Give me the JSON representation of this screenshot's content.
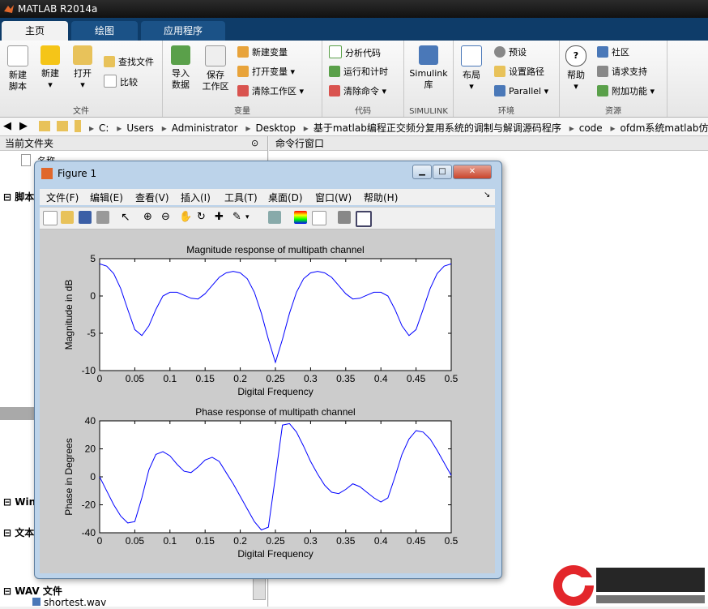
{
  "app": {
    "title": "MATLAB R2014a"
  },
  "tabs": [
    {
      "label": "主页",
      "active": true
    },
    {
      "label": "绘图",
      "active": false
    },
    {
      "label": "应用程序",
      "active": false
    }
  ],
  "ribbon": {
    "file": {
      "group": "文件",
      "new_script": [
        "新建",
        "脚本"
      ],
      "new": "新建",
      "open": "打开",
      "find_files": "查找文件",
      "compare": "比较"
    },
    "variable": {
      "group": "变量",
      "import": [
        "导入",
        "数据"
      ],
      "save_ws": [
        "保存",
        "工作区"
      ],
      "new_var": "新建变量",
      "open_var": "打开变量",
      "clear_ws": "清除工作区"
    },
    "code": {
      "group": "代码",
      "analyze": "分析代码",
      "run_time": "运行和计时",
      "clear_cmd": "清除命令"
    },
    "simulink": {
      "group": "SIMULINK",
      "lib": [
        "Simulink",
        "库"
      ]
    },
    "env": {
      "group": "环境",
      "layout": "布局",
      "prefs": "预设",
      "set_path": "设置路径",
      "parallel": "Parallel"
    },
    "resources": {
      "group": "资源",
      "help": "帮助",
      "community": "社区",
      "support": "请求支持",
      "addons": "附加功能"
    }
  },
  "address": {
    "crumbs": [
      "C:",
      "Users",
      "Administrator",
      "Desktop",
      "基于matlab编程正交频分复用系统的调制与解调源码程序",
      "code",
      "ofdm系统matlab仿"
    ]
  },
  "left_panel": {
    "title": "当前文件夹",
    "col_name": "名称",
    "sections": [
      "脚本",
      "Win",
      "文本",
      "WAV 文件"
    ],
    "file": "shortest.wav"
  },
  "cmd_panel": {
    "title": "命令行窗口"
  },
  "figure": {
    "title": "Figure 1",
    "menus": [
      "文件(F)",
      "编辑(E)",
      "查看(V)",
      "插入(I)",
      "工具(T)",
      "桌面(D)",
      "窗口(W)",
      "帮助(H)"
    ]
  },
  "chart_data": [
    {
      "type": "line",
      "title": "Magnitude response of multipath channel",
      "xlabel": "Digital Frequency",
      "ylabel": "Magnitude in dB",
      "xlim": [
        0,
        0.5
      ],
      "ylim": [
        -10,
        5
      ],
      "xticks": [
        "0",
        "0.05",
        "0.1",
        "0.15",
        "0.2",
        "0.25",
        "0.3",
        "0.35",
        "0.4",
        "0.45",
        "0.5"
      ],
      "yticks": [
        "5",
        "0",
        "-5",
        "-10"
      ],
      "grid": false,
      "color": "#0000ff",
      "x": [
        0,
        0.01,
        0.02,
        0.03,
        0.04,
        0.05,
        0.06,
        0.07,
        0.08,
        0.09,
        0.1,
        0.11,
        0.12,
        0.13,
        0.14,
        0.15,
        0.16,
        0.17,
        0.18,
        0.19,
        0.2,
        0.21,
        0.22,
        0.23,
        0.24,
        0.25,
        0.26,
        0.27,
        0.28,
        0.29,
        0.3,
        0.31,
        0.32,
        0.33,
        0.34,
        0.35,
        0.36,
        0.37,
        0.38,
        0.39,
        0.4,
        0.41,
        0.42,
        0.43,
        0.44,
        0.45,
        0.46,
        0.47,
        0.48,
        0.49,
        0.5
      ],
      "y": [
        4.3,
        4.0,
        3.0,
        1.0,
        -1.8,
        -4.5,
        -5.3,
        -4.0,
        -1.8,
        0.0,
        0.5,
        0.5,
        0.1,
        -0.3,
        -0.4,
        0.3,
        1.4,
        2.5,
        3.1,
        3.3,
        3.1,
        2.3,
        0.5,
        -2.3,
        -5.8,
        -8.9,
        -5.8,
        -2.3,
        0.5,
        2.3,
        3.1,
        3.3,
        3.1,
        2.5,
        1.4,
        0.3,
        -0.4,
        -0.3,
        0.1,
        0.5,
        0.5,
        0.0,
        -1.8,
        -4.0,
        -5.3,
        -4.5,
        -1.8,
        1.0,
        3.0,
        4.0,
        4.3
      ]
    },
    {
      "type": "line",
      "title": "Phase response of multipath channel",
      "xlabel": "Digital Frequency",
      "ylabel": "Phase in Degrees",
      "xlim": [
        0,
        0.5
      ],
      "ylim": [
        -40,
        40
      ],
      "xticks": [
        "0",
        "0.05",
        "0.1",
        "0.15",
        "0.2",
        "0.25",
        "0.3",
        "0.35",
        "0.4",
        "0.45",
        "0.5"
      ],
      "yticks": [
        "40",
        "20",
        "0",
        "-20",
        "-40"
      ],
      "grid": false,
      "color": "#0000ff",
      "x": [
        0,
        0.01,
        0.02,
        0.03,
        0.04,
        0.05,
        0.06,
        0.07,
        0.08,
        0.09,
        0.1,
        0.11,
        0.12,
        0.13,
        0.14,
        0.15,
        0.16,
        0.17,
        0.18,
        0.19,
        0.2,
        0.21,
        0.22,
        0.23,
        0.24,
        0.25,
        0.26,
        0.27,
        0.28,
        0.29,
        0.3,
        0.31,
        0.32,
        0.33,
        0.34,
        0.35,
        0.36,
        0.37,
        0.38,
        0.39,
        0.4,
        0.41,
        0.42,
        0.43,
        0.44,
        0.45,
        0.46,
        0.47,
        0.48,
        0.49,
        0.5
      ],
      "y": [
        0,
        -10,
        -20,
        -28,
        -33,
        -32,
        -15,
        5,
        16,
        18,
        15,
        9,
        4,
        3,
        7,
        12,
        14,
        11,
        3,
        -5,
        -14,
        -23,
        -32,
        -38,
        -36,
        0,
        37,
        38,
        32,
        22,
        11,
        2,
        -6,
        -11,
        -12,
        -9,
        -5,
        -7,
        -11,
        -15,
        -18,
        -15,
        0,
        16,
        27,
        33,
        32,
        27,
        19,
        10,
        1
      ]
    }
  ]
}
